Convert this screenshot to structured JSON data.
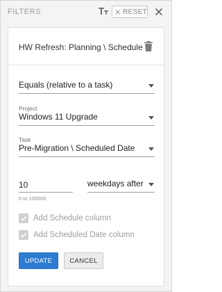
{
  "header": {
    "title": "FILTERS",
    "text_size_icon": "text-size-icon",
    "reset_label": "RESET",
    "close_icon": "close-icon"
  },
  "filter": {
    "name": "HW Refresh: Planning \\ Schedule",
    "delete_icon": "trash-icon",
    "operator": "Equals (relative to a task)",
    "project_label": "Project",
    "project_value": "Windows 11 Upgrade",
    "task_label": "Task",
    "task_value": "Pre-Migration \\ Scheduled Date",
    "offset_value": "10",
    "offset_hint": "0 to 100000",
    "unit_value": "weekdays after ...",
    "add_schedule_label": "Add Schedule column",
    "add_schedule_checked": true,
    "add_scheduled_date_label": "Add Scheduled Date column",
    "add_scheduled_date_checked": true
  },
  "actions": {
    "update_label": "UPDATE",
    "cancel_label": "CANCEL"
  },
  "colors": {
    "primary": "#2d7bd0",
    "panel_bg": "#f4f4f4",
    "card_bg": "#ffffff",
    "muted_text": "#9e9e9e"
  }
}
